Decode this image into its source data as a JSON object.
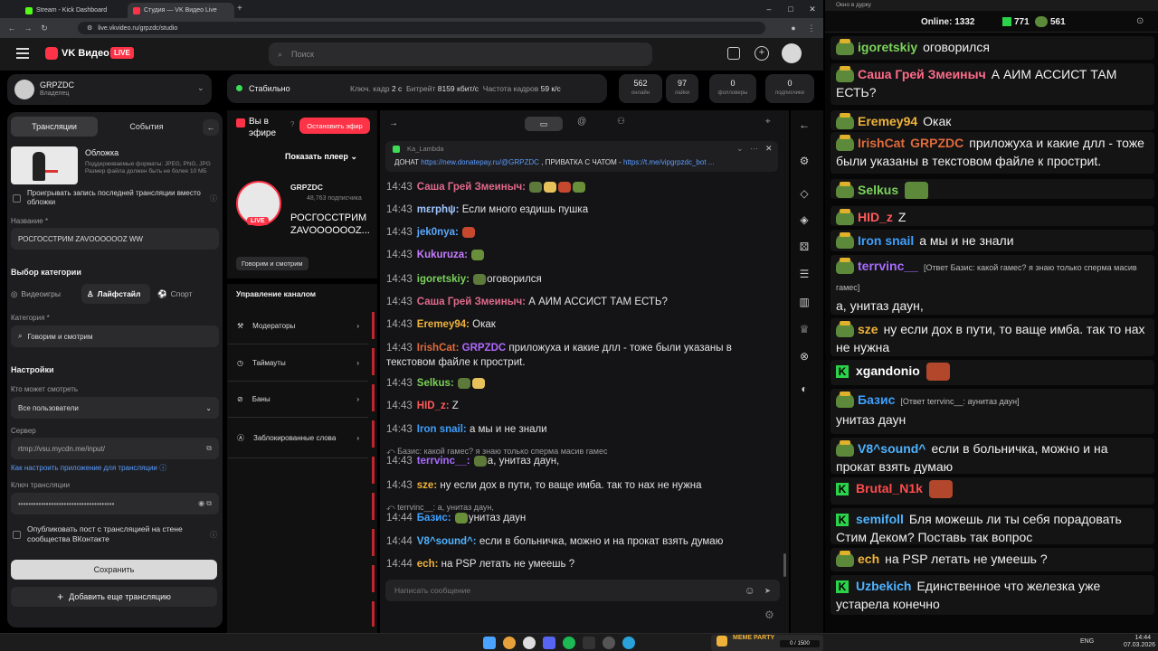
{
  "browser": {
    "tabs": [
      {
        "title": "Stream - Kick Dashboard",
        "color": "#53fc18"
      },
      {
        "title": "Студия — VK Видео Live",
        "color": "#ff3347"
      }
    ],
    "url": "live.vkvideo.ru/grpzdc/studio"
  },
  "header": {
    "logo": "VK Видео",
    "live_badge": "LIVE",
    "search_placeholder": "Поиск"
  },
  "channel": {
    "name": "GRPZDC",
    "role": "Владелец"
  },
  "tabs_left": {
    "broadcasts": "Трансляции",
    "events": "События"
  },
  "cover": {
    "title": "Обложка",
    "hint": "Поддерживаемые форматы: JPEG, PNG, JPG Размер файла должен быть не более 10 МБ",
    "replay_label": "Проигрывать запись последней трансляции вместо обложки"
  },
  "form": {
    "name_label": "Название *",
    "name_value": "РОСГОССТРИМ ZAVOOOOOOZ WW",
    "category_choice_label": "Выбор категории",
    "cat_buttons": [
      "Видеоигры",
      "Лайфстайл",
      "Спорт"
    ],
    "category_label": "Категория *",
    "category_value": "Говорим и смотрим",
    "settings_label": "Настройки",
    "who_label": "Кто может смотреть",
    "who_value": "Все пользователи",
    "server_label": "Сервер",
    "server_value": "rtmp://vsu.mycdn.me/input/",
    "setup_link": "Как настроить приложение для трансляции",
    "key_label": "Ключ трансляции",
    "key_value": "••••••••••••••••••••••••••••••••••••••",
    "publish_label": "Опубликовать пост с трансляцией на стене сообщества ВКонтакте",
    "save": "Сохранить",
    "add": "Добавить еще трансляцию"
  },
  "status": {
    "state": "Стабильно",
    "key_frame_label": "Ключ. кадр",
    "key_frame_value": "2 с",
    "bitrate_label": "Битрейт",
    "bitrate_value": "8159 кбит/с",
    "fps_label": "Частота кадров",
    "fps_value": "59 к/с"
  },
  "stats": [
    {
      "n": "562",
      "t": "онлайн"
    },
    {
      "n": "97",
      "t": "лайки"
    },
    {
      "n": "0",
      "t": "фолловеры"
    },
    {
      "n": "0",
      "t": "подписчики"
    }
  ],
  "live": {
    "on_air": "Вы в эфире",
    "stop": "Остановить эфир",
    "show_player": "Показать плеер",
    "streamer": "GRPZDC",
    "subs": "48,763 подписчика",
    "title": "РОСГОССТРИМ ZAVOOOOOOZ...",
    "category": "Говорим и смотрим",
    "live_badge": "LIVE"
  },
  "moderation": {
    "title": "Управление каналом",
    "items": [
      "Модераторы",
      "Таймауты",
      "Баны",
      "Заблокированные слова"
    ]
  },
  "pinned": {
    "user": "Ka_Lambda",
    "text": "ДОНАТ",
    "link1": "https://new.donatepay.ru/@GRPZDC",
    "mid": ", ПРИВАТКА С ЧАТОМ -",
    "link2": "https://t.me/vipgrpzdc_bot ..."
  },
  "chat": [
    {
      "time": "14:43",
      "user": "Саша Грей Змеиныч:",
      "color": "#e06a8c",
      "text": "",
      "emotes": 4
    },
    {
      "time": "14:43",
      "user": "mεrphψ:",
      "color": "#9fc5ff",
      "text": "Если много ездишь пушка"
    },
    {
      "time": "14:43",
      "user": "jek0nya:",
      "color": "#5aa9ff",
      "text": "",
      "emotes": 1
    },
    {
      "time": "14:43",
      "user": "Kukuruza:",
      "color": "#c77dff",
      "text": "",
      "emotes": 1
    },
    {
      "time": "14:43",
      "user": "igoretskiy:",
      "color": "#7bd35a",
      "text": "оговорился",
      "emotes": 1
    },
    {
      "time": "14:43",
      "user": "Саша Грей Змеиныч:",
      "color": "#e06a8c",
      "text": "А АИМ АССИСТ ТАМ ЕСТЬ?"
    },
    {
      "time": "14:43",
      "user": "Eremey94:",
      "color": "#f0b33a",
      "text": "Окак"
    },
    {
      "time": "14:43",
      "user": "IrishCat:",
      "color": "#e06a3c",
      "text": "приложуха и какие длл - тоже были указаны в",
      "mention": "GRPZDC",
      "cont": "текстовом файле к простриt."
    },
    {
      "time": "14:43",
      "user": "Selkus:",
      "color": "#7bd35a",
      "text": "",
      "emotes": 2
    },
    {
      "time": "14:43",
      "user": "HID_z:",
      "color": "#ff5a5a",
      "text": "Z"
    },
    {
      "time": "14:43",
      "user": "Iron snail:",
      "color": "#3fa0ff",
      "text": "а мы и не знали"
    },
    {
      "reply": "Базис: какой гамес? я знаю только сперма масив гамес"
    },
    {
      "time": "14:43",
      "user": "terrvinc__:",
      "color": "#a76cff",
      "text": "а,  унитаз даун,",
      "emotes": 1
    },
    {
      "time": "14:43",
      "user": "sze:",
      "color": "#f0b33a",
      "text": "ну если дох в пути, то ваще имба. так то нах не нужна"
    },
    {
      "reply": "terrvinc__: а, унитаз даун,"
    },
    {
      "time": "14:44",
      "user": "Базис:",
      "color": "#3fa0ff",
      "text": "унитаз даун",
      "emotes": 1
    },
    {
      "time": "14:44",
      "user": "V8^sound^:",
      "color": "#4fb3ff",
      "text": "если в больничка, можно и на прокат взять думаю"
    },
    {
      "time": "14:44",
      "user": "ech:",
      "color": "#f0b33a",
      "text": " на PSP летать не умеешь ?"
    }
  ],
  "chat_input_placeholder": "Написать сообщение",
  "right": {
    "window_title": "Окно в дурку",
    "online_label": "Online:",
    "online_value": "1332",
    "kick_count": "771",
    "vk_count": "561",
    "messages": [
      {
        "user": "igoretskiy",
        "color": "#7bd35a",
        "text": "оговорился",
        "src": "vk"
      },
      {
        "user": "Саша Грей Змеиныч",
        "color": "#ff6b8a",
        "text": "А АИМ АССИСТ ТАМ ЕСТЬ?",
        "src": "vk"
      },
      {
        "user": "Eremey94",
        "color": "#f0b33a",
        "text": "Окак",
        "src": "vk"
      },
      {
        "user": "IrishCat",
        "color": "#e06a3c",
        "text": "приложуха и какие длл - тоже были указаны в текстовом файле к простриt.",
        "mention": "GRPZDC",
        "src": "vk"
      },
      {
        "user": "Selkus",
        "color": "#7bd35a",
        "text": "",
        "src": "vk"
      },
      {
        "user": "HID_z",
        "color": "#ff5a5a",
        "text": "Z",
        "src": "vk"
      },
      {
        "user": "Iron snail",
        "color": "#3fa0ff",
        "text": "а мы и не знали",
        "src": "vk"
      },
      {
        "user": "terrvinc__",
        "color": "#a76cff",
        "reply": "[Ответ Базис: какой гамес? я знаю только сперма масив гамес]",
        "text": "а,  унитаз даун,",
        "src": "vk"
      },
      {
        "user": "sze",
        "color": "#f0b33a",
        "text": "ну если дох в пути, то ваще имба. так то нах не нужна",
        "src": "vk"
      },
      {
        "user": "xgandonio",
        "color": "#ffffff",
        "text": "",
        "src": "kick"
      },
      {
        "user": "Базис",
        "color": "#3fa0ff",
        "reply": "[Ответ terrvinc__: аунитаз даун]",
        "text": "унитаз даун",
        "src": "vk"
      },
      {
        "user": "V8^sound^",
        "color": "#4fb3ff",
        "text": "если в больничка, можно и на прокат взять думаю",
        "src": "vk"
      },
      {
        "user": "Brutal_N1k",
        "color": "#ff4b4b",
        "text": "",
        "src": "kick"
      },
      {
        "user": "semifoll",
        "color": "#4fb3ff",
        "text": "Бля можешь ли ты себя порадовать Стим Деком? Поставь так вопрос",
        "src": "kick"
      },
      {
        "user": "ech",
        "color": "#f0b33a",
        "text": "на PSP летать не умеешь ?",
        "src": "vk"
      },
      {
        "user": "Uzbekich",
        "color": "#4fb3ff",
        "text": "Единственное что железка уже устарела конечно",
        "src": "kick"
      }
    ]
  },
  "taskbar": {
    "lang": "ENG",
    "time": "14:44",
    "date": "07.03.2026",
    "widget": "MEME PARTY",
    "widget_progress": "0 / 1500"
  }
}
